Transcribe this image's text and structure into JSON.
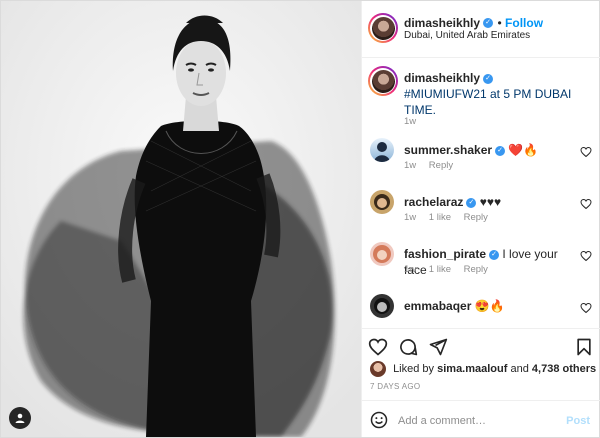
{
  "post": {
    "username": "dimasheikhly",
    "follow_label": "Follow",
    "location": "Dubai, United Arab Emirates"
  },
  "caption": {
    "username": "dimasheikhly",
    "text": "#MIUMIUFW21 at 5 PM DUBAI TIME.",
    "time": "1w"
  },
  "comments": [
    {
      "username": "summer.shaker",
      "text": "❤️🔥",
      "time": "1w",
      "likes": "",
      "reply": "Reply"
    },
    {
      "username": "rachelaraz",
      "text": "♥♥♥",
      "time": "1w",
      "likes": "1 like",
      "reply": "Reply"
    },
    {
      "username": "fashion_pirate",
      "text": "I love your face",
      "time": "1w",
      "likes": "1 like",
      "reply": "Reply"
    },
    {
      "username": "emmabaqer",
      "text": "😍🔥",
      "time": "",
      "likes": "",
      "reply": ""
    }
  ],
  "likes": {
    "prefix": "Liked by",
    "user": "sima.maalouf",
    "connector": "and",
    "count": "4,738 others"
  },
  "date": "7 DAYS AGO",
  "add_comment": {
    "placeholder": "Add a comment…",
    "post_label": "Post"
  },
  "colors": {
    "accent": "#0095f6",
    "verified": "#3897f0",
    "muted": "#8e8e8e",
    "border": "#efefef"
  },
  "icons": [
    "user-tag-icon",
    "verified-icon",
    "heart-icon",
    "comment-icon",
    "share-icon",
    "bookmark-icon",
    "emoji-icon"
  ]
}
